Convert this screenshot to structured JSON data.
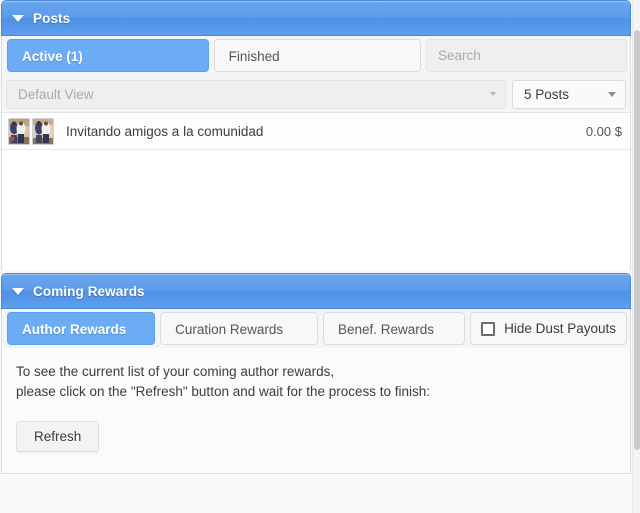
{
  "posts_panel": {
    "header": {
      "title": "Posts",
      "collapse_icon": "caret-down-icon"
    },
    "tabs": [
      {
        "label": "Active (1)",
        "active": true
      },
      {
        "label": "Finished",
        "active": false
      }
    ],
    "search": {
      "value": "",
      "placeholder": "Search"
    },
    "filters": {
      "view_select": {
        "selected": "Default View",
        "arrow_icon": "chevron-down-icon"
      },
      "count_select": {
        "selected": "5 Posts",
        "arrow_icon": "chevron-down-icon"
      }
    },
    "list": {
      "rows": [
        {
          "title": "Invitando amigos a la comunidad",
          "payout": "0.00 $",
          "thumbnails": 2
        }
      ]
    }
  },
  "rewards_panel": {
    "header": {
      "title": "Coming Rewards",
      "collapse_icon": "caret-down-icon"
    },
    "tabs": [
      {
        "label": "Author Rewards",
        "active": true
      },
      {
        "label": "Curation Rewards",
        "active": false
      },
      {
        "label": "Benef. Rewards",
        "active": false
      }
    ],
    "dust_checkbox": {
      "label": "Hide Dust Payouts",
      "checked": false
    },
    "body": {
      "line1": "To see the current list of your coming author rewards,",
      "line2": "please click on the \"Refresh\" button and wait for the process to finish:",
      "refresh_label": "Refresh"
    }
  },
  "colors": {
    "header_blue": "#5b9bea",
    "active_tab_blue": "#6bacf5",
    "page_background": "#f8f9fa",
    "text_primary": "#3c3c3c",
    "text_muted": "#a7a9ab"
  }
}
